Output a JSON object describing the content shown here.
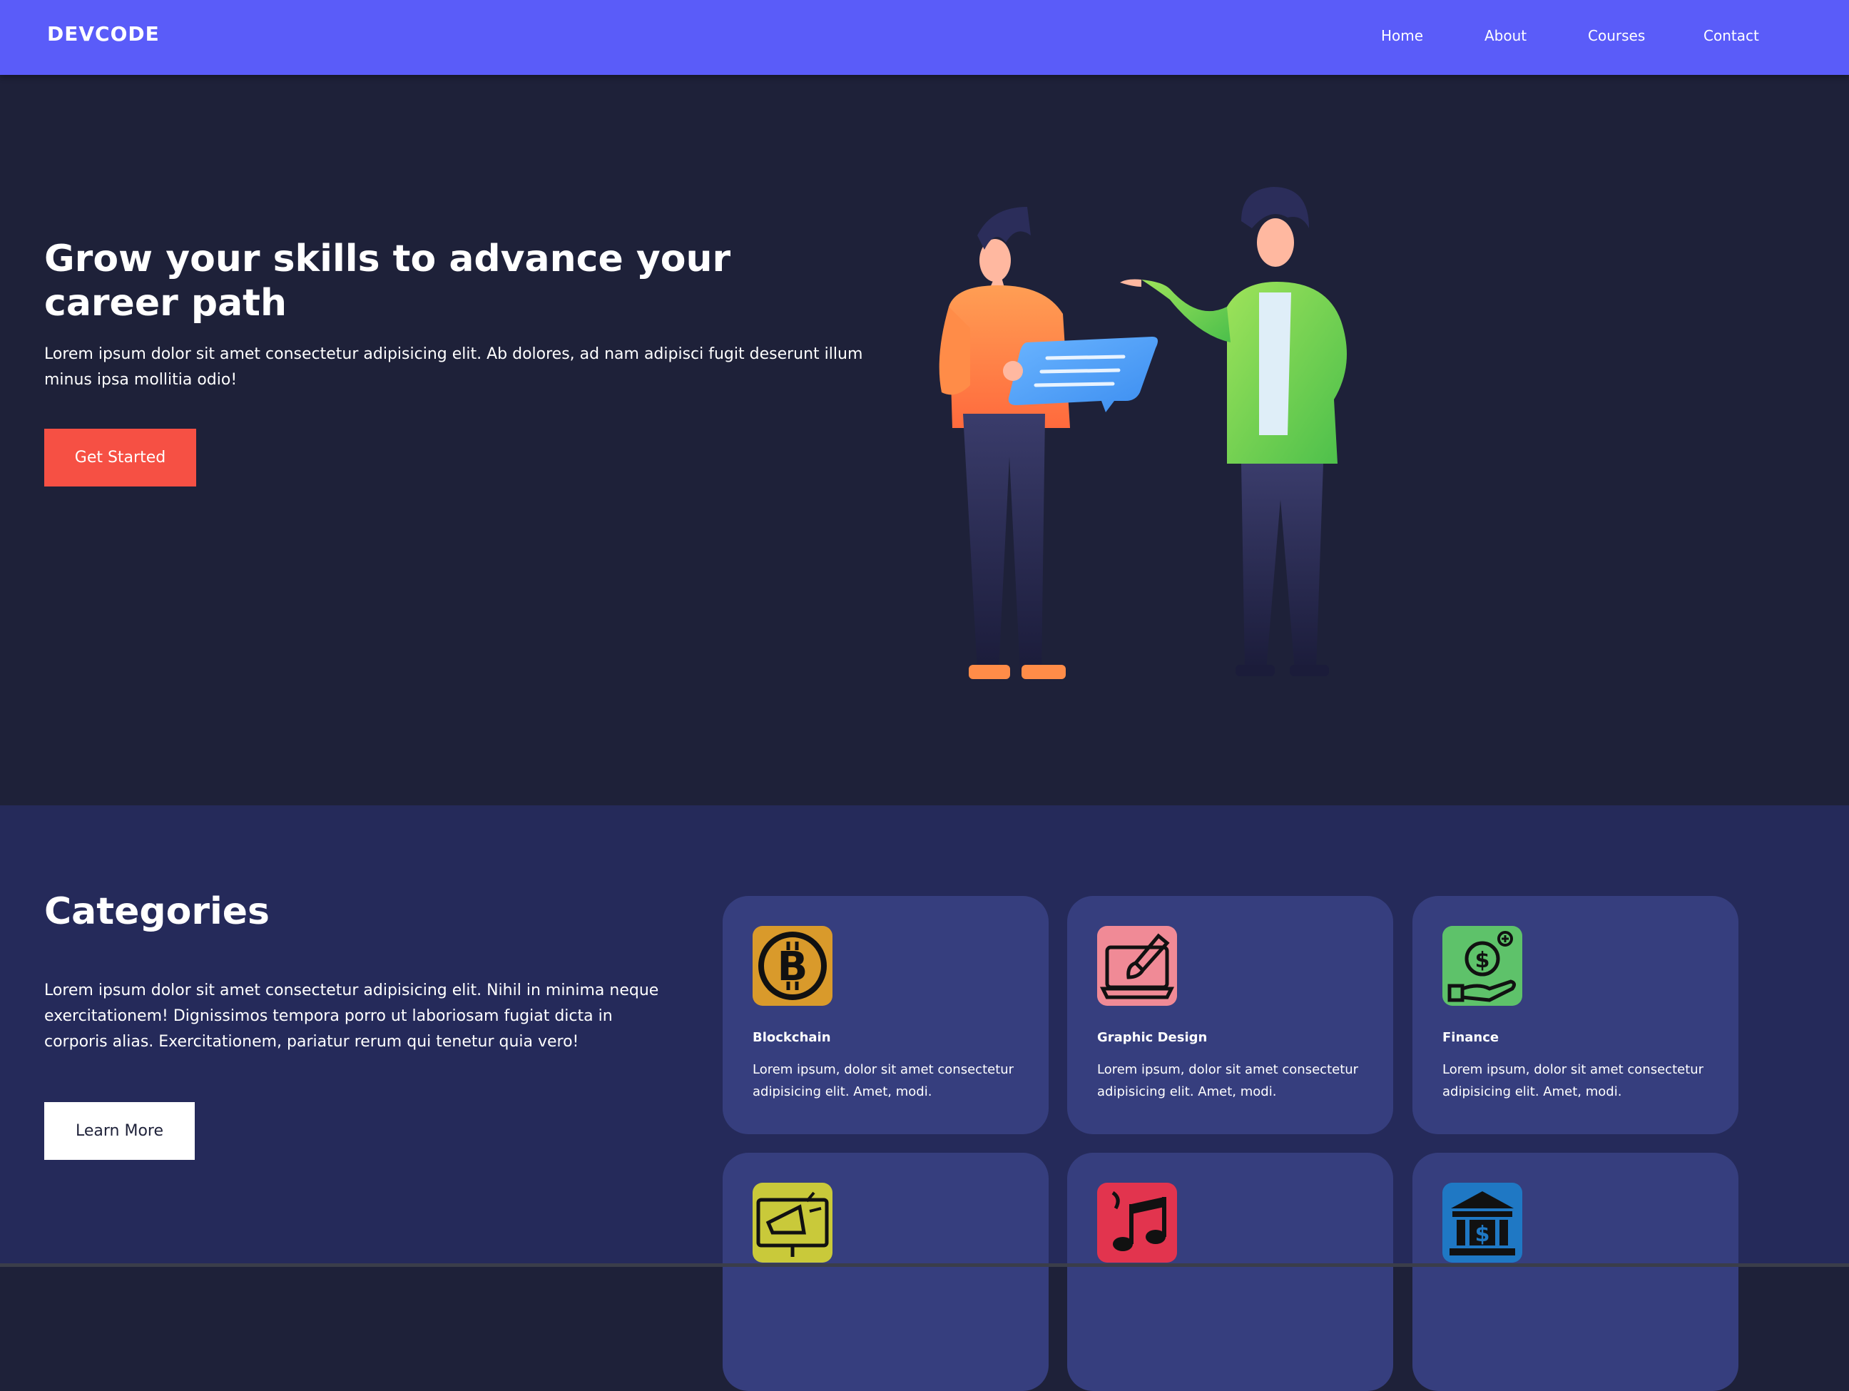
{
  "nav": {
    "brand": "DEVCODE",
    "links": [
      "Home",
      "About",
      "Courses",
      "Contact"
    ],
    "bg_color": "#5a5cf9"
  },
  "hero": {
    "title": "Grow your skills to advance your career path",
    "text": "Lorem ipsum dolor sit amet consectetur adipisicing elit. Ab dolores, ad nam adipisci fugit deserunt illum minus ipsa mollitia odio!",
    "button_label": "Get Started",
    "button_color": "#f65044",
    "illustration": "two-people-discussing-illustration"
  },
  "categories": {
    "title": "Categories",
    "text": "Lorem ipsum dolor sit amet consectetur adipisicing elit. Nihil in minima neque exercitationem! Dignissimos tempora porro ut laboriosam fugiat dicta in corporis alias. Exercitationem, pariatur rerum qui tenetur quia vero!",
    "button_label": "Learn More",
    "cards": [
      {
        "name": "Blockchain",
        "desc": "Lorem ipsum, dolor sit amet consectetur adipisicing elit. Amet, modi.",
        "icon": "bitcoin-icon",
        "color": "#d99a2b"
      },
      {
        "name": "Graphic Design",
        "desc": "Lorem ipsum, dolor sit amet consectetur adipisicing elit. Amet, modi.",
        "icon": "design-laptop-icon",
        "color": "#f08a96"
      },
      {
        "name": "Finance",
        "desc": "Lorem ipsum, dolor sit amet consectetur adipisicing elit. Amet, modi.",
        "icon": "finance-hand-coin-icon",
        "color": "#5ec26a"
      },
      {
        "name": "",
        "desc": "",
        "icon": "marketing-megaphone-icon",
        "color": "#c9c93a"
      },
      {
        "name": "",
        "desc": "",
        "icon": "music-notes-icon",
        "color": "#e2344e"
      },
      {
        "name": "",
        "desc": "",
        "icon": "bank-icon",
        "color": "#1f78c4"
      }
    ]
  }
}
